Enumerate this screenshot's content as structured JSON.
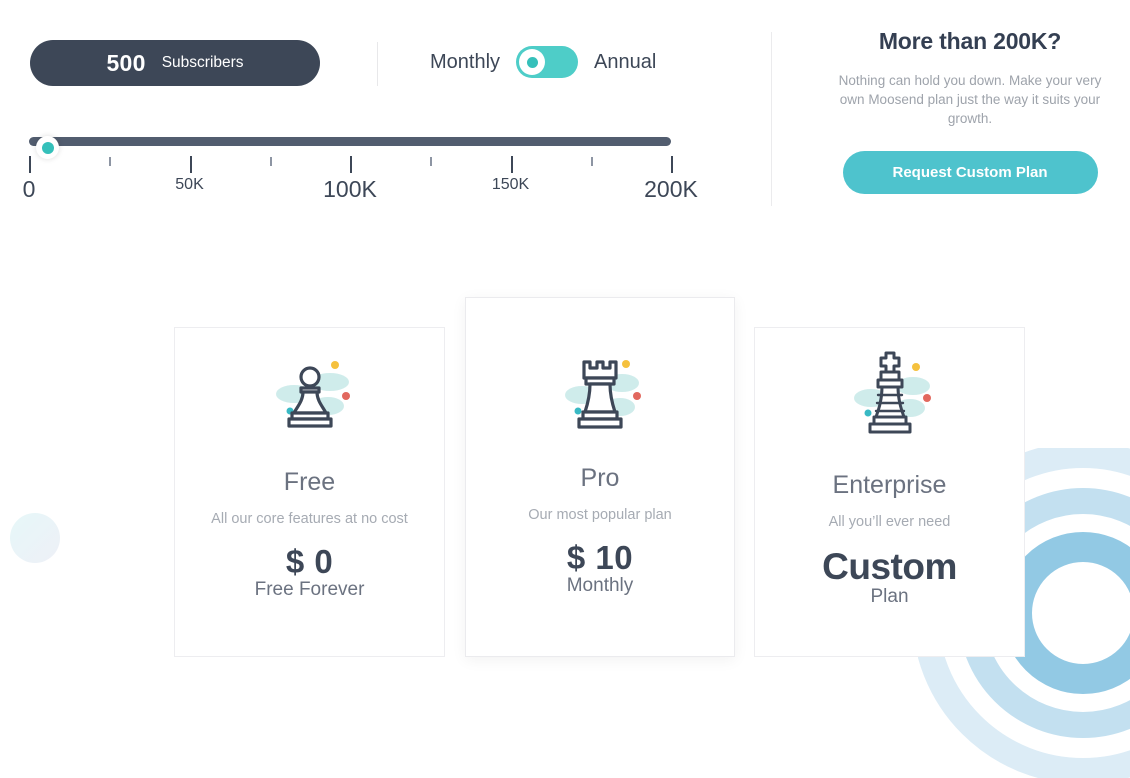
{
  "subscriber_pill": {
    "count": "500",
    "label": "Subscribers"
  },
  "billing_toggle": {
    "monthly_label": "Monthly",
    "annual_label": "Annual",
    "selected": "Monthly",
    "accent_color": "#4ecdc8"
  },
  "slider": {
    "value": "500",
    "min": "0",
    "max": "200K",
    "handle_color": "#35c0ba",
    "track_color": "#525d6f",
    "ticks": [
      {
        "label": "0",
        "type": "major",
        "pos": 0
      },
      {
        "label": "",
        "type": "minor",
        "pos": 12.5
      },
      {
        "label": "50K",
        "type": "major",
        "pos": 25
      },
      {
        "label": "",
        "type": "minor",
        "pos": 37.5
      },
      {
        "label": "100K",
        "type": "major",
        "pos": 50
      },
      {
        "label": "",
        "type": "minor",
        "pos": 62.5
      },
      {
        "label": "150K",
        "type": "major",
        "pos": 75
      },
      {
        "label": "",
        "type": "minor",
        "pos": 87.5
      },
      {
        "label": "200K",
        "type": "major",
        "pos": 100
      }
    ]
  },
  "custom_panel": {
    "title": "More than 200K?",
    "description": "Nothing can hold you down. Make your very own Moosend plan just the way it suits your growth.",
    "button_label": "Request Custom Plan",
    "button_color": "#4ec3cd"
  },
  "plans": [
    {
      "id": "free",
      "icon": "chess-pawn-icon",
      "name": "Free",
      "tagline": "All our core features at no cost",
      "price": "$ 0",
      "price_note": "Free Forever",
      "featured": false
    },
    {
      "id": "pro",
      "icon": "chess-rook-icon",
      "name": "Pro",
      "tagline": "Our most popular plan",
      "price": "$ 10",
      "price_note": "Monthly",
      "featured": true
    },
    {
      "id": "enterprise",
      "icon": "chess-king-icon",
      "name": "Enterprise",
      "tagline": "All you’ll ever need",
      "price": "Custom",
      "price_note": "Plan",
      "featured": false
    }
  ],
  "theme": {
    "dark_slate": "#3d4757",
    "teal": "#4ecdc8",
    "muted_gray": "#a6abb3",
    "blob_teal": "#bfe6e4",
    "dot_yellow": "#f5c13e",
    "dot_red": "#e2685e",
    "dot_teal": "#38b9c4"
  }
}
